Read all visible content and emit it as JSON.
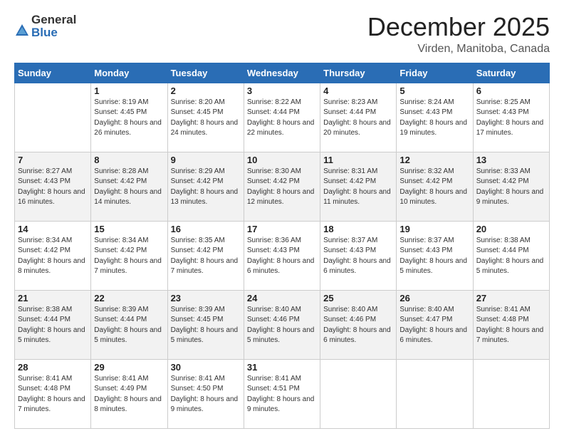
{
  "logo": {
    "general": "General",
    "blue": "Blue"
  },
  "title": "December 2025",
  "location": "Virden, Manitoba, Canada",
  "days_header": [
    "Sunday",
    "Monday",
    "Tuesday",
    "Wednesday",
    "Thursday",
    "Friday",
    "Saturday"
  ],
  "weeks": [
    [
      {
        "day": "",
        "info": ""
      },
      {
        "day": "1",
        "info": "Sunrise: 8:19 AM\nSunset: 4:45 PM\nDaylight: 8 hours\nand 26 minutes."
      },
      {
        "day": "2",
        "info": "Sunrise: 8:20 AM\nSunset: 4:45 PM\nDaylight: 8 hours\nand 24 minutes."
      },
      {
        "day": "3",
        "info": "Sunrise: 8:22 AM\nSunset: 4:44 PM\nDaylight: 8 hours\nand 22 minutes."
      },
      {
        "day": "4",
        "info": "Sunrise: 8:23 AM\nSunset: 4:44 PM\nDaylight: 8 hours\nand 20 minutes."
      },
      {
        "day": "5",
        "info": "Sunrise: 8:24 AM\nSunset: 4:43 PM\nDaylight: 8 hours\nand 19 minutes."
      },
      {
        "day": "6",
        "info": "Sunrise: 8:25 AM\nSunset: 4:43 PM\nDaylight: 8 hours\nand 17 minutes."
      }
    ],
    [
      {
        "day": "7",
        "info": "Sunrise: 8:27 AM\nSunset: 4:43 PM\nDaylight: 8 hours\nand 16 minutes."
      },
      {
        "day": "8",
        "info": "Sunrise: 8:28 AM\nSunset: 4:42 PM\nDaylight: 8 hours\nand 14 minutes."
      },
      {
        "day": "9",
        "info": "Sunrise: 8:29 AM\nSunset: 4:42 PM\nDaylight: 8 hours\nand 13 minutes."
      },
      {
        "day": "10",
        "info": "Sunrise: 8:30 AM\nSunset: 4:42 PM\nDaylight: 8 hours\nand 12 minutes."
      },
      {
        "day": "11",
        "info": "Sunrise: 8:31 AM\nSunset: 4:42 PM\nDaylight: 8 hours\nand 11 minutes."
      },
      {
        "day": "12",
        "info": "Sunrise: 8:32 AM\nSunset: 4:42 PM\nDaylight: 8 hours\nand 10 minutes."
      },
      {
        "day": "13",
        "info": "Sunrise: 8:33 AM\nSunset: 4:42 PM\nDaylight: 8 hours\nand 9 minutes."
      }
    ],
    [
      {
        "day": "14",
        "info": "Sunrise: 8:34 AM\nSunset: 4:42 PM\nDaylight: 8 hours\nand 8 minutes."
      },
      {
        "day": "15",
        "info": "Sunrise: 8:34 AM\nSunset: 4:42 PM\nDaylight: 8 hours\nand 7 minutes."
      },
      {
        "day": "16",
        "info": "Sunrise: 8:35 AM\nSunset: 4:42 PM\nDaylight: 8 hours\nand 7 minutes."
      },
      {
        "day": "17",
        "info": "Sunrise: 8:36 AM\nSunset: 4:43 PM\nDaylight: 8 hours\nand 6 minutes."
      },
      {
        "day": "18",
        "info": "Sunrise: 8:37 AM\nSunset: 4:43 PM\nDaylight: 8 hours\nand 6 minutes."
      },
      {
        "day": "19",
        "info": "Sunrise: 8:37 AM\nSunset: 4:43 PM\nDaylight: 8 hours\nand 5 minutes."
      },
      {
        "day": "20",
        "info": "Sunrise: 8:38 AM\nSunset: 4:44 PM\nDaylight: 8 hours\nand 5 minutes."
      }
    ],
    [
      {
        "day": "21",
        "info": "Sunrise: 8:38 AM\nSunset: 4:44 PM\nDaylight: 8 hours\nand 5 minutes."
      },
      {
        "day": "22",
        "info": "Sunrise: 8:39 AM\nSunset: 4:44 PM\nDaylight: 8 hours\nand 5 minutes."
      },
      {
        "day": "23",
        "info": "Sunrise: 8:39 AM\nSunset: 4:45 PM\nDaylight: 8 hours\nand 5 minutes."
      },
      {
        "day": "24",
        "info": "Sunrise: 8:40 AM\nSunset: 4:46 PM\nDaylight: 8 hours\nand 5 minutes."
      },
      {
        "day": "25",
        "info": "Sunrise: 8:40 AM\nSunset: 4:46 PM\nDaylight: 8 hours\nand 6 minutes."
      },
      {
        "day": "26",
        "info": "Sunrise: 8:40 AM\nSunset: 4:47 PM\nDaylight: 8 hours\nand 6 minutes."
      },
      {
        "day": "27",
        "info": "Sunrise: 8:41 AM\nSunset: 4:48 PM\nDaylight: 8 hours\nand 7 minutes."
      }
    ],
    [
      {
        "day": "28",
        "info": "Sunrise: 8:41 AM\nSunset: 4:48 PM\nDaylight: 8 hours\nand 7 minutes."
      },
      {
        "day": "29",
        "info": "Sunrise: 8:41 AM\nSunset: 4:49 PM\nDaylight: 8 hours\nand 8 minutes."
      },
      {
        "day": "30",
        "info": "Sunrise: 8:41 AM\nSunset: 4:50 PM\nDaylight: 8 hours\nand 9 minutes."
      },
      {
        "day": "31",
        "info": "Sunrise: 8:41 AM\nSunset: 4:51 PM\nDaylight: 8 hours\nand 9 minutes."
      },
      {
        "day": "",
        "info": ""
      },
      {
        "day": "",
        "info": ""
      },
      {
        "day": "",
        "info": ""
      }
    ]
  ]
}
